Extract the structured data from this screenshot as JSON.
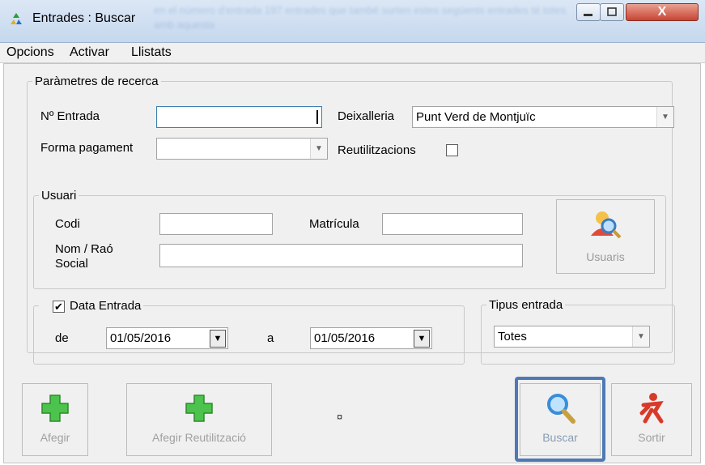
{
  "window": {
    "title": "Entrades : Buscar",
    "close_glyph": "X",
    "background_text": "en el número d'entrada 197 entrades que també surten estes següents entrades té totes amb aquesta"
  },
  "menu": {
    "items": [
      "Opcions",
      "Activar",
      "Llistats"
    ]
  },
  "search_params": {
    "legend": "Paràmetres de recerca",
    "entry_number_label": "Nº Entrada",
    "entry_number_value": "",
    "point_label": "Deixalleria",
    "point_value": "Punt Verd de Montjuïc",
    "payment_label": "Forma pagament",
    "payment_value": "",
    "reuse_label": "Reutilitzacions",
    "reuse_checked": false
  },
  "user": {
    "legend": "Usuari",
    "code_label": "Codi",
    "code_value": "",
    "plate_label": "Matrícula",
    "plate_value": "",
    "name_label": "Nom / Raó Social",
    "name_value": "",
    "users_button": "Usuaris"
  },
  "date": {
    "legend": "Data Entrada",
    "checked": true,
    "check_glyph": "✔",
    "from_label": "de",
    "from_value": "01/05/2016",
    "to_label": "a",
    "to_value": "01/05/2016"
  },
  "entry_type": {
    "legend": "Tipus entrada",
    "value": "Totes"
  },
  "actions": {
    "add": "Afegir",
    "add_reuse": "Afegir Reutilització",
    "search": "Buscar",
    "exit": "Sortir",
    "small_marker": "¤"
  },
  "colors": {
    "highlight": "#4e79b5",
    "add_icon": "#4cc34c",
    "search_icon": "#5aa8e8",
    "exit_icon": "#d83a2a"
  }
}
